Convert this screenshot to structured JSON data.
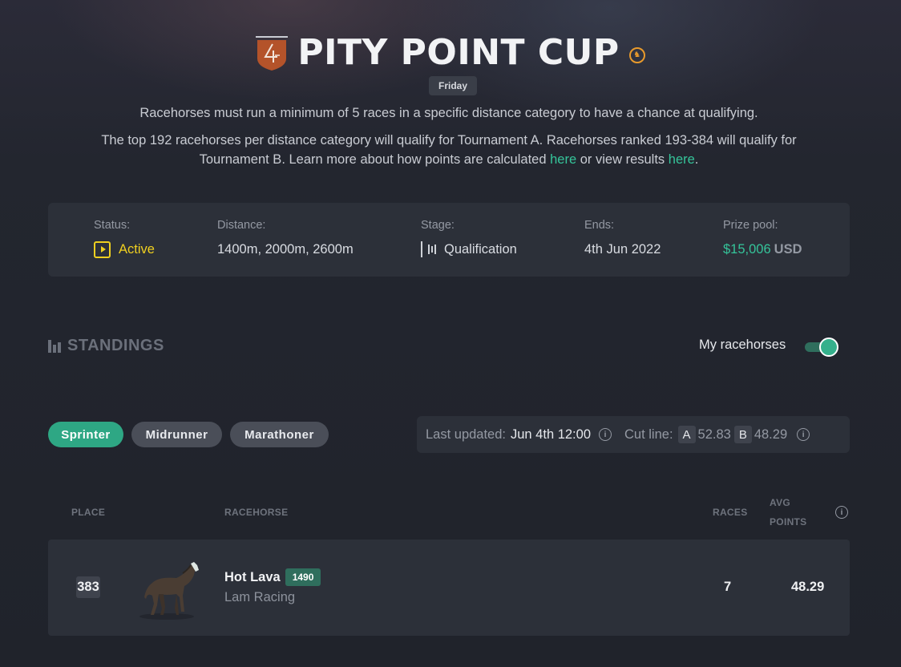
{
  "header": {
    "title": "PITY POINT CUP",
    "day": "Friday",
    "line1": "Racehorses must run a minimum of 5 races in a specific distance category to have a chance at qualifying.",
    "line2a": "The top 192 racehorses per distance category will qualify for Tournament A. Racehorses ranked 193-384 will qualify for",
    "line2b_pre": "Tournament B. Learn more about how points are calculated ",
    "link1": "here",
    "line2b_mid": " or view results ",
    "link2": "here",
    "line2b_end": ".",
    "brand_color": "#b4532a"
  },
  "info": {
    "status_label": "Status:",
    "status_value": "Active",
    "distance_label": "Distance:",
    "distance_value": "1400m, 2000m, 2600m",
    "stage_label": "Stage:",
    "stage_value": "Qualification",
    "ends_label": "Ends:",
    "ends_value": "4th Jun 2022",
    "prize_label": "Prize pool:",
    "prize_amount": "$15,006",
    "prize_currency": "USD",
    "status_color": "#f0d020",
    "accent_color": "#35c49a"
  },
  "standings": {
    "label": "STANDINGS",
    "my_racehorses": "My racehorses",
    "toggle_on": true
  },
  "categories": [
    {
      "label": "Sprinter",
      "active": true
    },
    {
      "label": "Midrunner",
      "active": false
    },
    {
      "label": "Marathoner",
      "active": false
    }
  ],
  "updated": {
    "label": "Last updated:",
    "value": "Jun 4th 12:00",
    "cut_label": "Cut line:",
    "tag_a": "A",
    "cut_a": "52.83",
    "tag_b": "B",
    "cut_b": "48.29"
  },
  "table": {
    "col_place": "PLACE",
    "col_racehorse": "RACEHORSE",
    "col_races": "RACES",
    "col_avg1": "AVG",
    "col_avg2": "POINTS",
    "rows": [
      {
        "place": "383",
        "name": "Hot Lava",
        "rating": "1490",
        "stable": "Lam Racing",
        "races": "7",
        "avg_points": "48.29"
      }
    ]
  }
}
